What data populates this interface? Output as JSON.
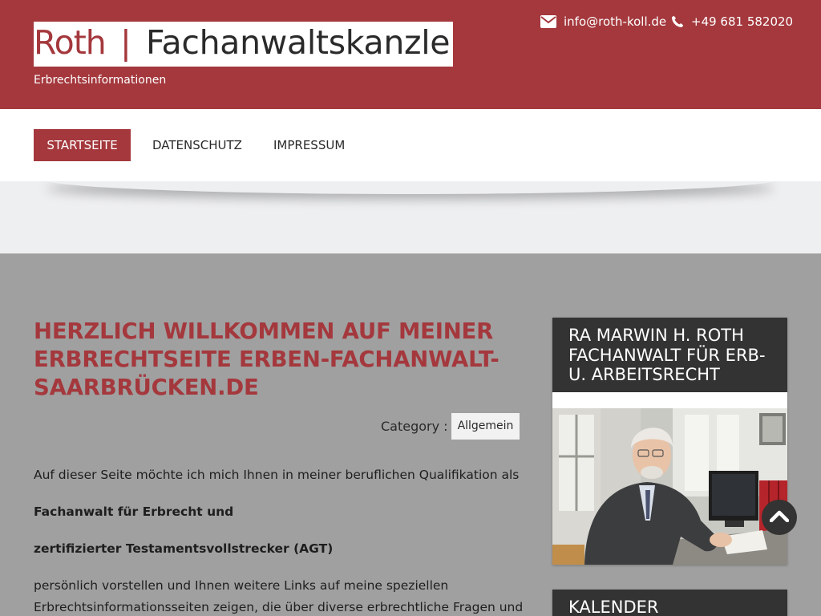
{
  "header": {
    "logo_brand": "Roth",
    "logo_separator": "|",
    "logo_rest": "Fachanwaltskanzlei",
    "tagline": "Erbrechtsinformationen",
    "email": "info@roth-koll.de",
    "email_icon": "envelope-icon",
    "phone": "+49 681 582020",
    "phone_icon": "phone-icon",
    "brand_color": "#a4383d"
  },
  "nav": {
    "items": [
      {
        "label": "STARTSEITE",
        "active": true
      },
      {
        "label": "DATENSCHUTZ",
        "active": false
      },
      {
        "label": "IMPRESSUM",
        "active": false
      }
    ]
  },
  "post": {
    "title": "HERZLICH WILLKOMMEN AUF MEINER ERBRECHTSEITE ERBEN-FACHANWALT-SAARBRÜCKEN.DE",
    "category_label": "Category :",
    "category_value": "Allgemein",
    "p1": "Auf dieser Seite möchte ich mich Ihnen in meiner beruflichen Qualifikation als",
    "b1": "Fachanwalt für Erbrecht und",
    "b2": "zertifizierter Testamentsvollstrecker (AGT)",
    "p2": "persönlich vorstellen und Ihnen weitere Links auf meine speziellen",
    "p3": "Erbrechtsinformationsseiten zeigen, die über diverse erbrechtliche Fragen und"
  },
  "sidebar": {
    "widget1_title": "RA MARWIN H. ROTH FACHANWALT FÜR ERB- U. ARBEITSRECHT",
    "widget2_title": "KALENDER"
  },
  "to_top_icon": "chevron-up-icon"
}
